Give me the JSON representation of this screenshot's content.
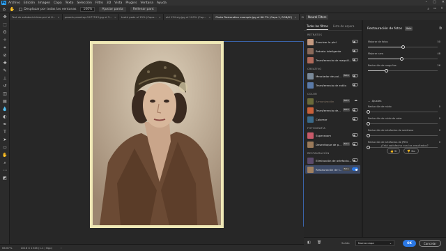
{
  "app": {
    "logo": "Ps"
  },
  "menu": [
    "Archivo",
    "Edición",
    "Imagen",
    "Capa",
    "Texto",
    "Selección",
    "Filtro",
    "3D",
    "Vista",
    "Plugins",
    "Ventana",
    "Ayuda"
  ],
  "window_controls": [
    "–",
    "▢",
    "✕"
  ],
  "options_bar": {
    "checkbox_label": "Desplazar por todas las ventanas",
    "zoom": "100%",
    "fit_label": "Ajustar panta",
    "fill_label": "Rellenar pant"
  },
  "tabs": [
    {
      "label": "Test de estabericidrias.psd al 6...",
      "active": false
    },
    {
      "label": "powels-pexelrop-2477513.jpg al 3...",
      "active": false
    },
    {
      "label": "teeth pads al 15% (Capa...",
      "active": false
    },
    {
      "label": "old 134 sig.jpg al 100% (Cap...",
      "active": false
    },
    {
      "label": "Photo Restoration example.jpg al 66.7% (Capa 1, RGB/8*)",
      "active": true
    },
    {
      "label": "Sin título-4 al 100% (Capa 0...",
      "active": false
    }
  ],
  "status": {
    "zoom": "66.67%",
    "doc": "1018 X 1346 (1.1 / Bpp)"
  },
  "neural_filters": {
    "panel_label": "Neural Filters",
    "tabs": [
      {
        "label": "Todos los filtros",
        "active": true
      },
      {
        "label": "Lista de espera",
        "active": false
      }
    ],
    "categories": [
      {
        "name": "RETRATOS",
        "filters": [
          {
            "name": "Suavizar la piel",
            "state": "off",
            "color": "#c49a80"
          },
          {
            "name": "Retrato inteligente",
            "state": "off",
            "color": "#8a6a5a"
          },
          {
            "name": "Transferencia de maquill...",
            "state": "off",
            "color": "#b06a5a"
          }
        ]
      },
      {
        "name": "CREATIVO",
        "filters": [
          {
            "name": "Mezclador de pai...",
            "beta": "Beta",
            "state": "off",
            "color": "#7a8a9a"
          },
          {
            "name": "Transferencia de estilo",
            "state": "off",
            "color": "#5a7aa8"
          }
        ]
      },
      {
        "name": "COLOR",
        "filters": [
          {
            "name": "Armonización",
            "beta": "Beta",
            "state": "cloud",
            "dim": true,
            "color": "#6a6a3a"
          },
          {
            "name": "Transferencia de...",
            "beta": "Beta",
            "state": "off",
            "color": "#c8603a"
          },
          {
            "name": "Colorear",
            "state": "off",
            "color": "#3a6a8a"
          }
        ]
      },
      {
        "name": "FOTOGRAFÍA",
        "filters": [
          {
            "name": "Superzoom",
            "state": "off",
            "color": "#c85a6a"
          },
          {
            "name": "Desenfoque de p...",
            "beta": "Beta",
            "state": "off",
            "color": "#9a7a5a"
          }
        ]
      },
      {
        "name": "RESTAURACIÓN",
        "filters": [
          {
            "name": "Eliminación de artefacto...",
            "state": "off",
            "color": "#5a4a6a"
          },
          {
            "name": "Restauración de f...",
            "beta": "Beta",
            "state": "on",
            "selected": true,
            "color": "#a08060"
          }
        ]
      }
    ],
    "detail": {
      "title": "Restauración de fotos",
      "beta": "Beta",
      "sliders": [
        {
          "label": "Mejorar de fotos",
          "value": 0.5,
          "value_label": "50"
        },
        {
          "label": "Mejorar cara",
          "value": 0.48,
          "value_label": "48"
        },
        {
          "label": "Reducción de rasguños",
          "value": 0.26,
          "value_label": "26"
        }
      ],
      "adjustments_label": "Ajustes",
      "adjust_sliders": [
        {
          "label": "Reducción de ruido",
          "value": 0.0,
          "value_label": "0"
        },
        {
          "label": "Reducción de ruido de color",
          "value": 0.0,
          "value_label": "0"
        },
        {
          "label": "Reducción de artefactos de semitono",
          "value": 0.0,
          "value_label": "0"
        },
        {
          "label": "Reducción de artefactos de JPEG",
          "value": 0.0,
          "value_label": "0"
        }
      ],
      "question": "¿Está satisfecho con los resultados?",
      "yes": "Sí",
      "no": "No"
    },
    "bottom": {
      "output_label": "Salida",
      "output_value": "Nueva capa",
      "ok": "OK",
      "cancel": "Cancelar"
    }
  }
}
